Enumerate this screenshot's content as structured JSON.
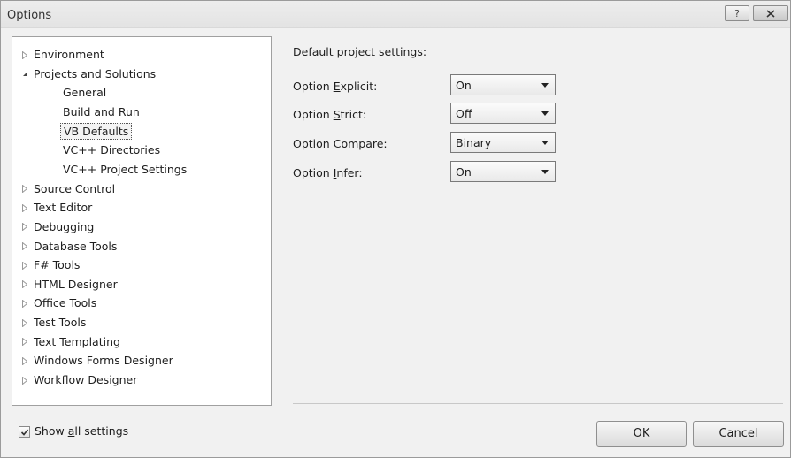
{
  "window": {
    "title": "Options",
    "help_label": "?"
  },
  "tree": {
    "items": [
      {
        "label": "Environment",
        "expander": "collapsed",
        "level": 0
      },
      {
        "label": "Projects and Solutions",
        "expander": "expanded",
        "level": 0
      },
      {
        "label": "General",
        "expander": "none",
        "level": 1
      },
      {
        "label": "Build and Run",
        "expander": "none",
        "level": 1
      },
      {
        "label": "VB Defaults",
        "expander": "none",
        "level": 1,
        "selected": true
      },
      {
        "label": "VC++ Directories",
        "expander": "none",
        "level": 1
      },
      {
        "label": "VC++ Project Settings",
        "expander": "none",
        "level": 1
      },
      {
        "label": "Source Control",
        "expander": "collapsed",
        "level": 0
      },
      {
        "label": "Text Editor",
        "expander": "collapsed",
        "level": 0
      },
      {
        "label": "Debugging",
        "expander": "collapsed",
        "level": 0
      },
      {
        "label": "Database Tools",
        "expander": "collapsed",
        "level": 0
      },
      {
        "label": "F# Tools",
        "expander": "collapsed",
        "level": 0
      },
      {
        "label": "HTML Designer",
        "expander": "collapsed",
        "level": 0
      },
      {
        "label": "Office Tools",
        "expander": "collapsed",
        "level": 0
      },
      {
        "label": "Test Tools",
        "expander": "collapsed",
        "level": 0
      },
      {
        "label": "Text Templating",
        "expander": "collapsed",
        "level": 0
      },
      {
        "label": "Windows Forms Designer",
        "expander": "collapsed",
        "level": 0
      },
      {
        "label": "Workflow Designer",
        "expander": "collapsed",
        "level": 0
      }
    ]
  },
  "settings": {
    "section_title": "Default project settings:",
    "options": [
      {
        "prefix": "Option ",
        "mnemonic": "E",
        "rest": "xplicit:",
        "value": "On"
      },
      {
        "prefix": "Option ",
        "mnemonic": "S",
        "rest": "trict:",
        "value": "Off"
      },
      {
        "prefix": "Option ",
        "mnemonic": "C",
        "rest": "ompare:",
        "value": "Binary"
      },
      {
        "prefix": "Option ",
        "mnemonic": "I",
        "rest": "nfer:",
        "value": "On"
      }
    ]
  },
  "footer": {
    "show_all": {
      "prefix": "Show ",
      "mnemonic": "a",
      "rest": "ll settings",
      "checked": true
    },
    "ok_label": "OK",
    "cancel_label": "Cancel"
  },
  "colors": {
    "window_bg": "#f1f1f1",
    "pane_bg": "#ffffff",
    "border": "#a0a0a0"
  }
}
